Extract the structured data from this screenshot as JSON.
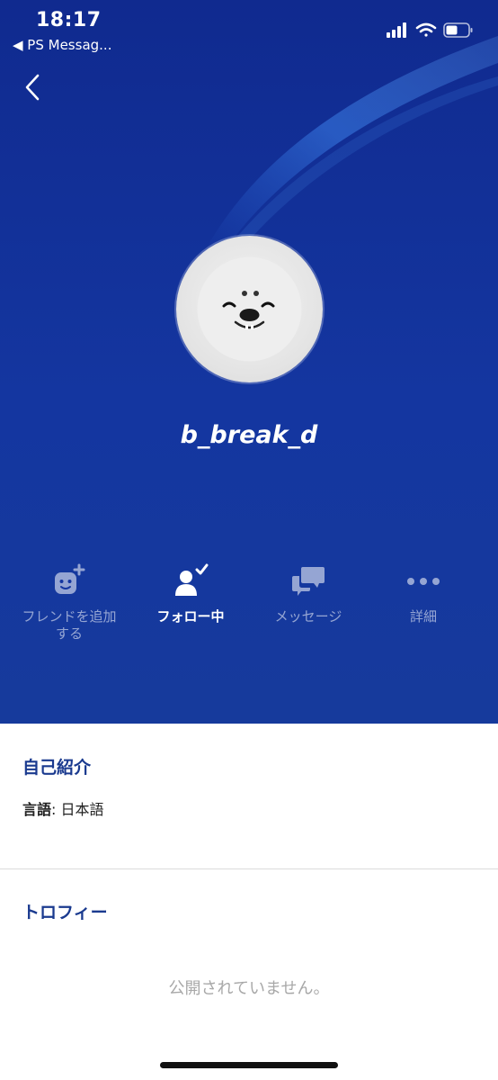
{
  "status_bar": {
    "time": "18:17",
    "back_app": "◀ PS Messag..."
  },
  "profile": {
    "username": "b_break_d",
    "avatar": "seal-face"
  },
  "actions": [
    {
      "label": "フレンドを追加する",
      "icon": "add-friend-icon",
      "active": false
    },
    {
      "label": "フォロー中",
      "icon": "following-icon",
      "active": true
    },
    {
      "label": "メッセージ",
      "icon": "message-icon",
      "active": false
    },
    {
      "label": "詳細",
      "icon": "more-icon",
      "active": false
    }
  ],
  "about": {
    "title": "自己紹介",
    "language_key": "言語",
    "language_value": "日本語"
  },
  "trophies": {
    "title": "トロフィー",
    "empty_text": "公開されていません。"
  },
  "colors": {
    "hero": "#1436a0",
    "section_title": "#1a3a8f"
  }
}
